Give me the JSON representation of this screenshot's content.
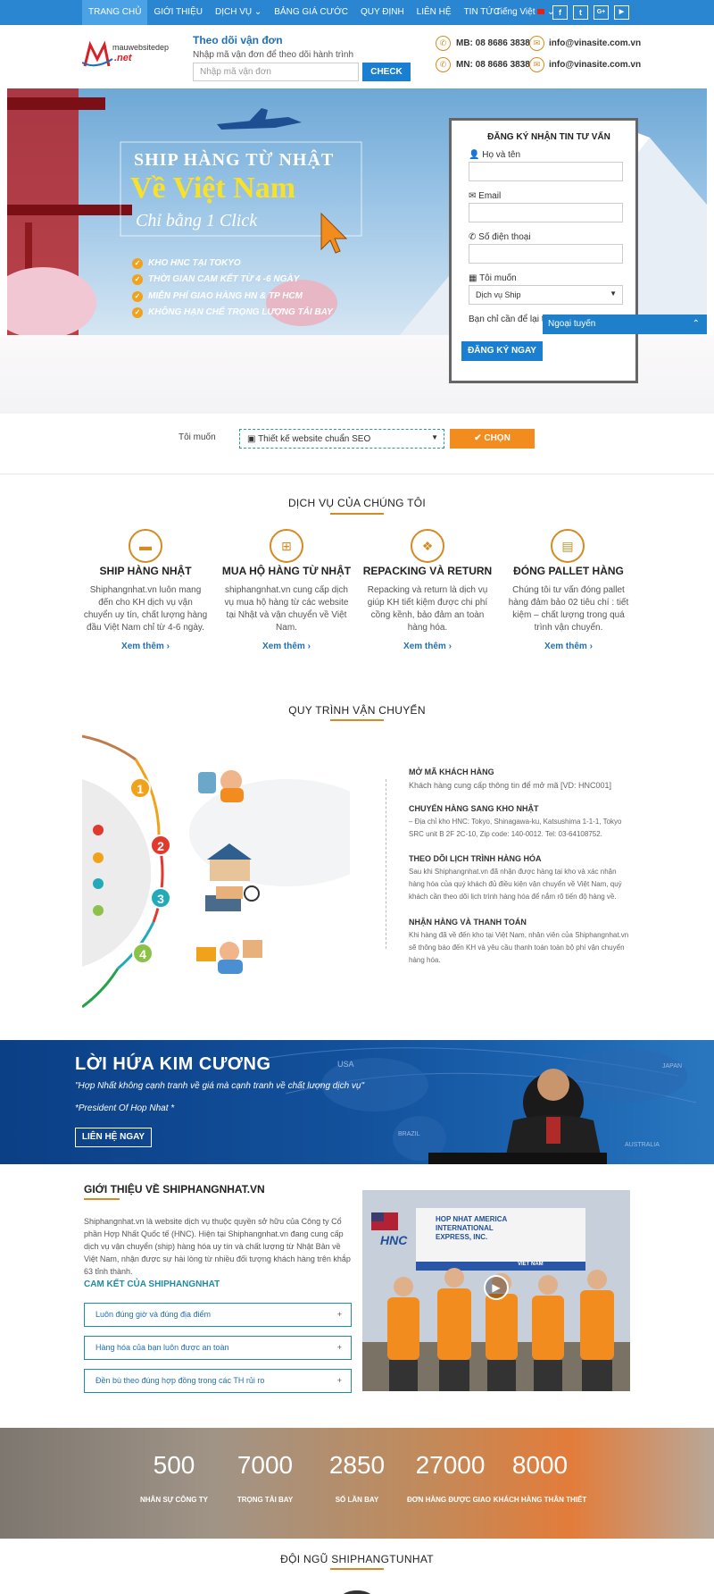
{
  "nav": {
    "items": [
      "TRANG CHỦ",
      "GIỚI THIỆU",
      "DỊCH VỤ",
      "BẢNG GIÁ CƯỚC",
      "QUY ĐỊNH",
      "LIÊN HỆ",
      "TIN TỨC"
    ],
    "dropdown_item": "DỊCH VỤ",
    "language": "Tiếng Việt",
    "social": [
      "f",
      "t",
      "G+",
      "▶"
    ]
  },
  "header": {
    "logo_text": "mauwebsitedep",
    "logo_sub": ".net",
    "track_title": "Theo dõi vận đơn",
    "track_sub": "Nhập mã vận đơn để theo dõi hành trình",
    "track_placeholder": "Nhập mã vận đơn",
    "track_button": "CHECK",
    "contacts": [
      "MB: 08 8686 3838",
      "info@vinasite.com.vn",
      "MN: 08 8686 3838",
      "info@vinasite.com.vn"
    ]
  },
  "hero": {
    "line1": "SHIP HÀNG TỪ NHẬT",
    "line2": "Về Việt Nam",
    "line3": "Chỉ bằng 1 Click",
    "features": [
      "KHO HNC TẠI TOKYO",
      "THỜI GIAN CAM KẾT TỪ 4 -6 NGÀY",
      "MIỄN PHÍ GIAO HÀNG HN & TP HCM",
      "KHÔNG HẠN CHẾ TRỌNG LƯỢNG TẢI BAY"
    ]
  },
  "form": {
    "title": "ĐĂNG KÝ NHẬN TIN TƯ VẤN",
    "name_label": "Họ và tên",
    "email_label": "Email",
    "phone_label": "Số điện thoại",
    "want_label": "Tôi muốn",
    "select_value": "Dịch vụ Ship",
    "note": "Bạn chỉ cần để lại th",
    "button": "ĐĂNG KÝ NGAY",
    "chat": "Ngoại tuyến"
  },
  "select_row": {
    "label": "Tôi muốn",
    "value": "Thiết kế website chuẩn SEO",
    "button": "CHỌN"
  },
  "services": {
    "title": "DỊCH VỤ CỦA CHÚNG TÔI",
    "items": [
      {
        "icon": "truck-icon",
        "title": "SHIP HÀNG NHẬT",
        "text": "Shiphangnhat.vn luôn mang đến cho KH dịch vụ vận chuyển uy tín, chất lượng hàng đầu Việt Nam chỉ từ 4-6 ngày.",
        "more": "Xem thêm"
      },
      {
        "icon": "basket-icon",
        "title": "MUA HỘ HÀNG TỪ NHẬT",
        "text": "shiphangnhat.vn cung cấp dịch vụ mua hộ hàng từ các website tại Nhật và vận chuyển về Việt Nam.",
        "more": "Xem thêm"
      },
      {
        "icon": "dropbox-icon",
        "title": "REPACKING VÀ RETURN",
        "text": "Repacking và return là dịch vụ giúp KH tiết kiệm được chi phí cồng kềnh, bảo đảm an toàn hàng hóa.",
        "more": "Xem thêm"
      },
      {
        "icon": "archive-icon",
        "title": "ĐÓNG PALLET HÀNG",
        "text": "Chúng tôi tư vấn đóng pallet hàng đảm bảo 02 tiêu chí : tiết kiệm – chất lượng trong quá trình vận chuyển.",
        "more": "Xem thêm"
      }
    ]
  },
  "process": {
    "title": "QUY TRÌNH VẬN CHUYỂN",
    "steps": [
      {
        "num": "1",
        "title": "MỞ MÃ KHÁCH HÀNG",
        "text": "Khách hàng cung cấp thông tin để mở mã [VD: HNC001]"
      },
      {
        "num": "2",
        "title": "CHUYỂN HÀNG SANG KHO NHẬT",
        "text": "– Địa chỉ kho HNC: Tokyo, Shinagawa-ku, Katsushima 1-1-1, Tokyo SRC unit B 2F 2C-10, Zip code: 140-0012. Tel: 03-64108752."
      },
      {
        "num": "3",
        "title": "THEO DÕI LỊCH TRÌNH HÀNG HÓA",
        "text": "Sau khi Shiphangnhat.vn đã nhận được hàng tại kho và xác nhận hàng hóa của quý khách đủ điều kiện vận chuyển về Việt Nam, quý khách cần theo dõi lịch trình hàng hóa để nắm rõ tiến độ hàng về."
      },
      {
        "num": "4",
        "title": "NHẬN HÀNG VÀ THANH TOÁN",
        "text": "Khi hàng đã về đến kho tại Việt Nam, nhân viên của Shiphangnhat.vn sẽ thông báo đến KH và yêu cầu thanh toán toàn bộ phí vận chuyển hàng hóa."
      }
    ]
  },
  "banner": {
    "title": "LỜI HỨA KIM CƯƠNG",
    "quote": "\"Hợp Nhất không cạnh tranh về giá mà cạnh tranh về chất lượng dịch vụ\"",
    "president": "*President Of Hop Nhat *",
    "button": "LIÊN HỆ NGAY",
    "map_labels": [
      "USA",
      "JAPAN",
      "BRAZIL",
      "AUSTRALIA"
    ]
  },
  "about": {
    "title": "GIỚI THIỆU VỀ SHIPHANGNHAT.VN",
    "text": "Shiphangnhat.vn là website dịch vụ thuộc quyền sở hữu của Công ty Cổ phần Hợp Nhất Quốc tế (HNC). Hiện tại Shiphangnhat.vn đang cung cấp dịch vụ vận chuyển (ship) hàng hóa uy tín và chất lượng từ Nhật Bản về Việt Nam, nhận được sự hài lòng từ nhiều đối tượng khách hàng trên khắp 63 tỉnh thành.",
    "commit_title": "CAM KẾT CỦA SHIPHANGNHAT",
    "accordion": [
      "Luôn đúng giờ và đúng địa điểm",
      "Hàng hóa của bạn luôn được an toàn",
      "Đền bù theo đúng hợp đồng trong các TH rủi ro"
    ],
    "sign": "HOP NHAT AMERICA INTERNATIONAL EXPRESS, INC.",
    "sign_short": "HNC",
    "viet": "VIET NAM"
  },
  "stats": [
    {
      "num": "500",
      "label": "NHÂN SỰ CÔNG TY"
    },
    {
      "num": "7000",
      "label": "TRỌNG TẢI BAY"
    },
    {
      "num": "2850",
      "label": "SỐ LẦN BAY"
    },
    {
      "num": "27000",
      "label": "ĐƠN HÀNG ĐƯỢC GIAO"
    },
    {
      "num": "8000",
      "label": "KHÁCH HÀNG THÂN THIẾT"
    }
  ],
  "team": {
    "title": "ĐỘI NGŨ SHIPHANGTUNHAT"
  },
  "colors": {
    "primary": "#2a86d1",
    "accent": "#d58b23",
    "orange": "#f28c1e",
    "teal": "#1f8ca3"
  }
}
